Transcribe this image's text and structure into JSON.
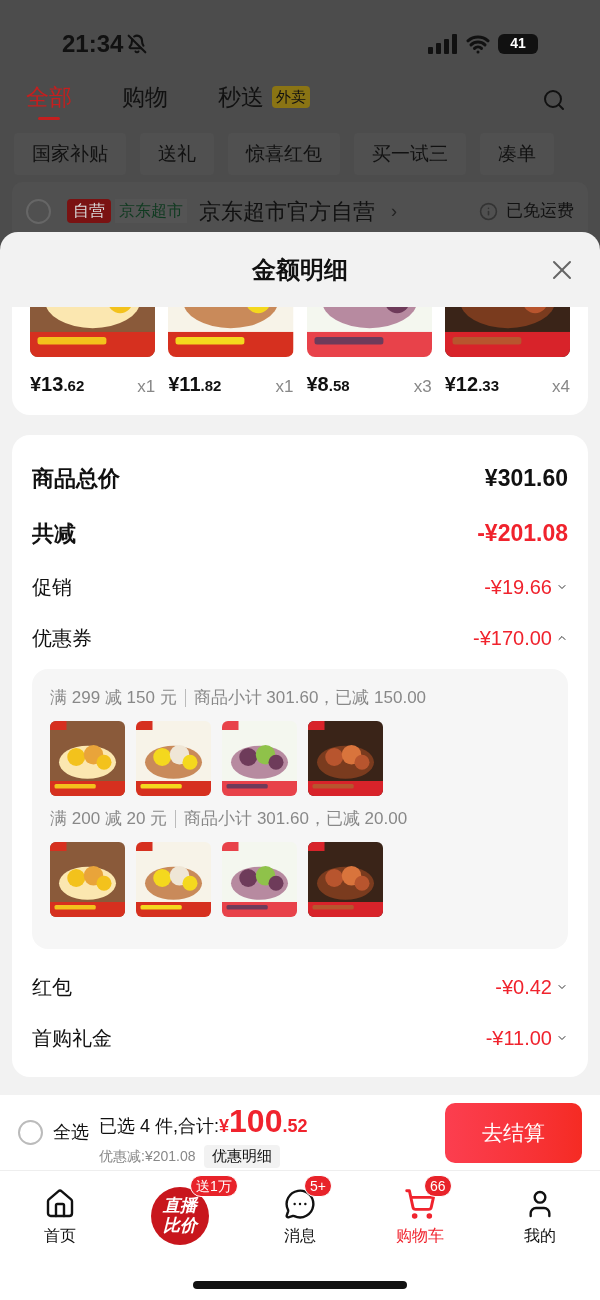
{
  "status_bar": {
    "time": "21:34",
    "battery": "41"
  },
  "tabs": [
    {
      "label": "全部",
      "selected": true
    },
    {
      "label": "购物",
      "selected": false
    },
    {
      "label": "秒送",
      "badge": "外卖",
      "selected": false
    }
  ],
  "chips": [
    "国家补贴",
    "送礼",
    "惊喜红包",
    "买一试三",
    "凑单"
  ],
  "store": {
    "checked": false,
    "tags": [
      {
        "label": "自营",
        "kind": "solid"
      },
      {
        "label": "京东超市",
        "kind": "outline"
      }
    ],
    "name": "京东超市官方自营",
    "arrow": "›",
    "shipping": "已免运费"
  },
  "sheet": {
    "title": "金额明细",
    "items": [
      {
        "price": "¥13",
        "cents": ".62",
        "qty": "x1"
      },
      {
        "price": "¥11",
        "cents": ".82",
        "qty": "x1"
      },
      {
        "price": "¥8",
        "cents": ".58",
        "qty": "x3"
      },
      {
        "price": "¥12",
        "cents": ".33",
        "qty": "x4"
      }
    ],
    "summary": [
      {
        "label": "商品总价",
        "value": "¥301.60",
        "kind": "total"
      },
      {
        "label": "共减",
        "value": "-¥201.08",
        "kind": "reduction"
      },
      {
        "label": "促销",
        "value": "-¥19.66",
        "kind": "detail",
        "expanded": false
      },
      {
        "label": "优惠券",
        "value": "-¥170.00",
        "kind": "detail",
        "expanded": true,
        "coupons": [
          {
            "rule": "满 299 减 150 元",
            "note": "商品小计 301.60，已减 150.00"
          },
          {
            "rule": "满 200 减 20 元",
            "note": "商品小计 301.60，已减 20.00"
          }
        ]
      },
      {
        "label": "红包",
        "value": "-¥0.42",
        "kind": "detail",
        "expanded": false
      },
      {
        "label": "首购礼金",
        "value": "-¥11.00",
        "kind": "detail",
        "expanded": false
      }
    ]
  },
  "bottom_bar": {
    "select_all": {
      "label": "全选",
      "checked": false
    },
    "summary": "已选 4 件,合计:",
    "currency": "¥",
    "total": "100",
    "cents": ".52",
    "savings": "优惠减:¥201.08",
    "details_button": "优惠明细",
    "checkout": "去结算"
  },
  "nav": [
    {
      "kind": "home",
      "label": "首页",
      "selected": false
    },
    {
      "kind": "live",
      "lines": [
        "直播",
        "比价"
      ],
      "badge": "送1万",
      "selected": false
    },
    {
      "kind": "message",
      "label": "消息",
      "badge": "5+",
      "selected": false
    },
    {
      "kind": "cart",
      "label": "购物车",
      "badge": "66",
      "selected": true
    },
    {
      "kind": "profile",
      "label": "我的",
      "selected": false
    }
  ]
}
